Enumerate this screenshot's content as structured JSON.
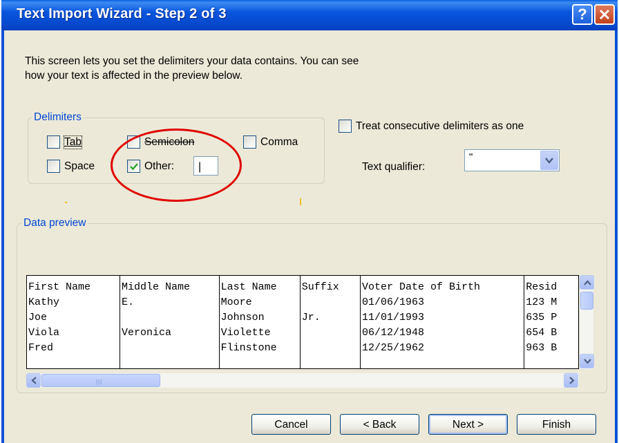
{
  "window": {
    "title": "Text Import Wizard - Step 2 of 3",
    "help_label": "?"
  },
  "description": {
    "line1": "This screen lets you set the delimiters your data contains.  You can see",
    "line2": "how your text is affected in the preview below."
  },
  "delimiters": {
    "legend": "Delimiters",
    "tab": {
      "label": "Tab",
      "checked": false
    },
    "semicolon": {
      "label": "Semicolon",
      "checked": false
    },
    "comma": {
      "label": "Comma",
      "checked": false
    },
    "space": {
      "label": "Space",
      "checked": false
    },
    "other": {
      "label": "Other:",
      "checked": true,
      "value": "|"
    }
  },
  "consecutive": {
    "label": "Treat consecutive delimiters as one",
    "checked": false
  },
  "qualifier": {
    "label": "Text qualifier:",
    "value": "\""
  },
  "preview": {
    "legend": "Data preview",
    "columns": [
      "First Name",
      "Middle Name",
      "Last Name",
      "Suffix",
      "Voter Date of Birth",
      "Resid"
    ],
    "rows": [
      [
        "Kathy",
        "E.",
        "Moore",
        "",
        "01/06/1963",
        "123 M"
      ],
      [
        "Joe",
        "",
        "Johnson",
        "Jr.",
        "11/01/1993",
        "635 P"
      ],
      [
        "Viola",
        "Veronica",
        "Violette",
        "",
        "06/12/1948",
        "654 B"
      ],
      [
        "Fred",
        "",
        "Flinstone",
        "",
        "12/25/1962",
        "963 B"
      ]
    ]
  },
  "buttons": {
    "cancel": "Cancel",
    "back": "< Back",
    "next": "Next >",
    "finish": "Finish"
  },
  "colors": {
    "titlebar": "#0855dd",
    "dialog_bg": "#ece9d8",
    "legend_text": "#0046d5",
    "annotation": "#e00000"
  }
}
